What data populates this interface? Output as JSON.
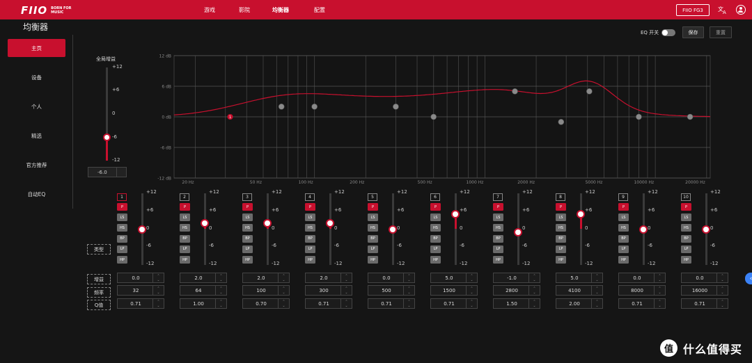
{
  "brand": {
    "logo_text": "FIIO",
    "tagline": "BORN FOR MUSIC"
  },
  "nav": {
    "tabs": [
      "游戏",
      "影院",
      "均衡器",
      "配置"
    ],
    "active": "均衡器"
  },
  "device": {
    "name": "FIIO FG3"
  },
  "icons": {
    "translate": "translate-icon",
    "account": "user-avatar-icon"
  },
  "page_title": "均衡器",
  "sidebar": {
    "items": [
      "主页",
      "设备",
      "个人",
      "精选",
      "官方推荐",
      "自动EQ"
    ],
    "active": "主页"
  },
  "eq_switch": {
    "label": "EQ 开关",
    "state": "off"
  },
  "buttons": {
    "save": "保存",
    "reset": "重置"
  },
  "global_gain": {
    "label": "全局增益",
    "ticks": [
      "+12",
      "+6",
      "0",
      "-6",
      "-12"
    ],
    "value": -6.0,
    "display": "-6.0"
  },
  "graph": {
    "y_ticks": [
      "12 dB",
      "6 dB",
      "0 dB",
      "-6 dB",
      "-12 dB"
    ],
    "x_ticks": [
      "20 Hz",
      "50 Hz",
      "100 Hz",
      "200 Hz",
      "500 Hz",
      "1000 Hz",
      "2000 Hz",
      "5000 Hz",
      "10000 Hz",
      "20000 Hz"
    ],
    "curve_color": "#c8102e",
    "selected_marker_label": "1"
  },
  "slider_ticks": [
    "+12",
    "+6",
    "0",
    "-6",
    "-12"
  ],
  "type_buttons": [
    "P",
    "LS",
    "HS",
    "BP",
    "LP",
    "HP"
  ],
  "row_labels": {
    "type": "类型",
    "gain": "增益",
    "freq": "频率",
    "q": "Q值"
  },
  "bands": [
    {
      "num": "1",
      "type": "P",
      "gain": "0.0",
      "freq": "32",
      "q": "0.71"
    },
    {
      "num": "2",
      "type": "P",
      "gain": "2.0",
      "freq": "64",
      "q": "1.00"
    },
    {
      "num": "3",
      "type": "P",
      "gain": "2.0",
      "freq": "100",
      "q": "0.70"
    },
    {
      "num": "4",
      "type": "P",
      "gain": "2.0",
      "freq": "300",
      "q": "0.71"
    },
    {
      "num": "5",
      "type": "P",
      "gain": "0.0",
      "freq": "500",
      "q": "0.71"
    },
    {
      "num": "6",
      "type": "P",
      "gain": "5.0",
      "freq": "1500",
      "q": "0.71"
    },
    {
      "num": "7",
      "type": "P",
      "gain": "-1.0",
      "freq": "2800",
      "q": "1.50"
    },
    {
      "num": "8",
      "type": "P",
      "gain": "5.0",
      "freq": "4100",
      "q": "2.00"
    },
    {
      "num": "9",
      "type": "P",
      "gain": "0.0",
      "freq": "8000",
      "q": "0.71"
    },
    {
      "num": "10",
      "type": "P",
      "gain": "0.0",
      "freq": "16000",
      "q": "0.71"
    }
  ],
  "selected_band": "1",
  "watermark": {
    "icon_char": "值",
    "text": "什么值得买"
  },
  "colors": {
    "accent": "#c8102e",
    "background": "#151515"
  }
}
